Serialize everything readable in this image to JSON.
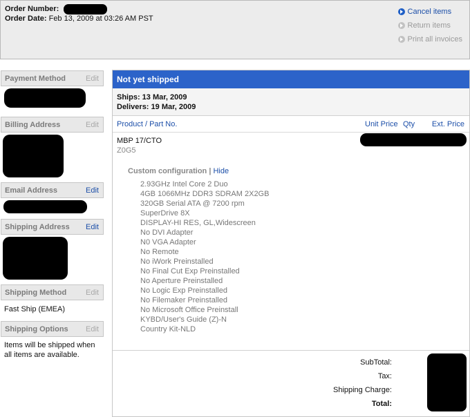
{
  "header": {
    "order_number_label": "Order Number:",
    "order_date_label": "Order Date:",
    "order_date_value": "Feb 13, 2009 at 03:26 AM PST",
    "actions": [
      {
        "label": "Cancel items",
        "state": "active"
      },
      {
        "label": "Return items",
        "state": "disabled"
      },
      {
        "label": "Print all invoices",
        "state": "disabled"
      }
    ]
  },
  "sidebar": {
    "payment_method": {
      "title": "Payment Method",
      "edit": "Edit"
    },
    "billing_address": {
      "title": "Billing Address",
      "edit": "Edit"
    },
    "email_address": {
      "title": "Email Address",
      "edit": "Edit"
    },
    "shipping_address": {
      "title": "Shipping Address",
      "edit": "Edit"
    },
    "shipping_method": {
      "title": "Shipping Method",
      "edit": "Edit",
      "value": "Fast Ship (EMEA)"
    },
    "shipping_options": {
      "title": "Shipping Options",
      "edit": "Edit",
      "value_line1": "Items will be shipped when",
      "value_line2": "all items are available."
    }
  },
  "shipment": {
    "status": "Not yet shipped",
    "ships": "Ships: 13 Mar, 2009",
    "delivers": "Delivers: 19 Mar, 2009",
    "columns": {
      "product": "Product / Part No.",
      "unit_price": "Unit Price",
      "qty": "Qty",
      "ext_price": "Ext. Price"
    },
    "product_name": "MBP 17/CTO",
    "product_code": "Z0G5",
    "config_label": "Custom configuration",
    "config_sep": "|",
    "config_toggle": "Hide",
    "config_items": [
      "2.93GHz Intel Core 2 Duo",
      "4GB 1066MHz DDR3 SDRAM 2X2GB",
      "320GB Serial ATA @ 7200 rpm",
      "SuperDrive 8X",
      "DISPLAY-HI RES, GL,Widescreen",
      "No DVI Adapter",
      "N0 VGA Adapter",
      "No Remote",
      "No iWork Preinstalled",
      "No Final Cut Exp Preinstalled",
      "No Aperture Preinstalled",
      "No Logic Exp Preinstalled",
      "No Filemaker Preinstalled",
      "No Microsoft Office Preinstall",
      "KYBD/User's Guide (Z)-N",
      "Country Kit-NLD"
    ],
    "totals": {
      "subtotal": "SubTotal:",
      "tax": "Tax:",
      "shipping": "Shipping Charge:",
      "total": "Total:"
    }
  },
  "colors": {
    "accent": "#2c63c9",
    "link": "#1b4ea8",
    "panel": "#ececec"
  }
}
